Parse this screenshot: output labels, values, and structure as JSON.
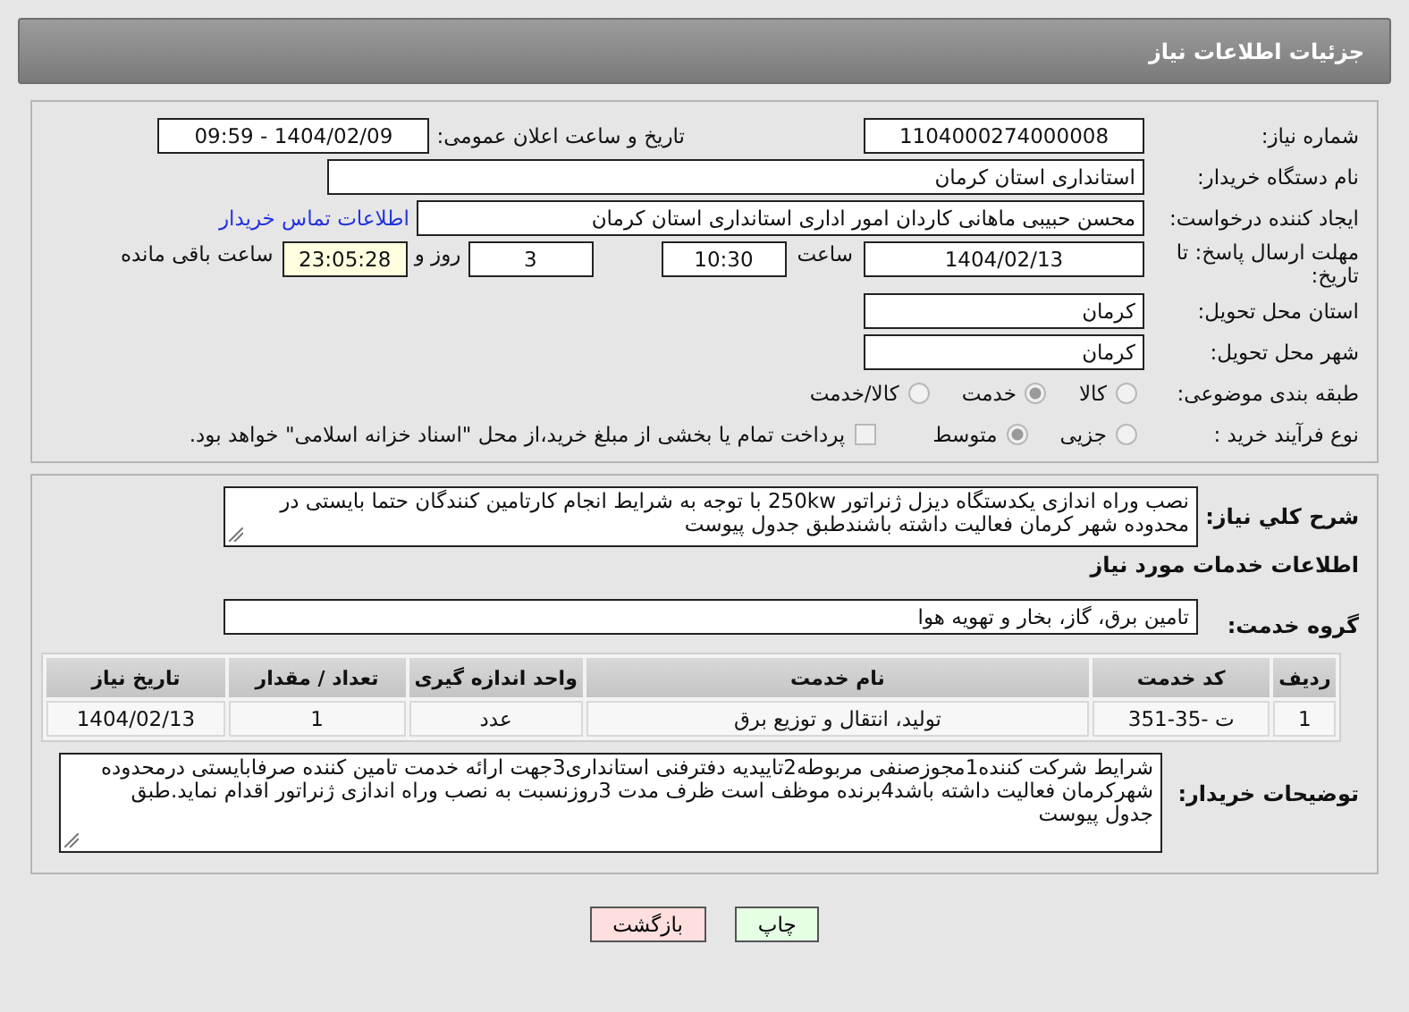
{
  "header": {
    "title": "جزئیات اطلاعات نیاز"
  },
  "need_number": {
    "label": "شماره نیاز:",
    "value": "1104000274000008"
  },
  "announce": {
    "label": "تاریخ و ساعت اعلان عمومی:",
    "value": "1404/02/09 - 09:59"
  },
  "buyer_org": {
    "label": "نام دستگاه خریدار:",
    "value": "استانداری استان کرمان"
  },
  "requester": {
    "label": "ایجاد کننده درخواست:",
    "value": "محسن حبیبی ماهانی کاردان امور اداری استانداری استان کرمان",
    "link": "اطلاعات تماس خریدار"
  },
  "deadline": {
    "label": "مهلت ارسال پاسخ: تا تاریخ:",
    "date": "1404/02/13",
    "time_label": "ساعت",
    "time": "10:30",
    "days": "3",
    "days_label": "روز و",
    "remaining": "23:05:28",
    "remaining_label": "ساعت باقی مانده"
  },
  "province": {
    "label": "استان محل تحویل:",
    "value": "کرمان"
  },
  "city": {
    "label": "شهر محل تحویل:",
    "value": "کرمان"
  },
  "category": {
    "label": "طبقه بندی موضوعی:",
    "options": [
      {
        "label": "کالا",
        "selected": false
      },
      {
        "label": "خدمت",
        "selected": true
      },
      {
        "label": "کالا/خدمت",
        "selected": false
      }
    ]
  },
  "process": {
    "label": "نوع فرآیند خرید :",
    "options": [
      {
        "label": "جزیی",
        "selected": false
      },
      {
        "label": "متوسط",
        "selected": true
      }
    ],
    "payment": {
      "checked": false,
      "text": "پرداخت تمام یا بخشی از مبلغ خرید،از محل \"اسناد خزانه اسلامی\" خواهد بود."
    }
  },
  "description": {
    "label": "شرح کلي نياز:",
    "value": "نصب وراه اندازی یکدستگاه دیزل ژنراتور 250kw با توجه به شرایط انجام کارتامین کنندگان حتما بایستی در محدوده شهر کرمان  فعالیت داشته باشندطبق جدول پیوست"
  },
  "services_heading": "اطلاعات خدمات مورد نیاز",
  "service_group": {
    "label": "گروه خدمت:",
    "value": "تامین برق، گاز، بخار و تهویه هوا"
  },
  "table": {
    "columns": [
      "ردیف",
      "کد خدمت",
      "نام خدمت",
      "واحد اندازه گیری",
      "تعداد / مقدار",
      "تاریخ نیاز"
    ],
    "rows": [
      [
        "1",
        "ت -35-351",
        "تولید، انتقال و توزیع برق",
        "عدد",
        "1",
        "1404/02/13"
      ]
    ]
  },
  "buyer_notes": {
    "label": "توضیحات خریدار:",
    "value": "شرایط شرکت کننده1مجوزصنفی مربوطه2تاییدیه دفترفنی استانداری3جهت ارائه خدمت تامین کننده صرفابایستی درمحدوده شهرکرمان فعالیت داشته باشد4برنده موظف است ظرف مدت 3روزنسبت به نصب وراه اندازی ژنراتور اقدام نماید.طبق جدول پیوست"
  },
  "buttons": [
    {
      "label": "چاپ",
      "kind": "print"
    },
    {
      "label": "بازگشت",
      "kind": "back"
    }
  ]
}
